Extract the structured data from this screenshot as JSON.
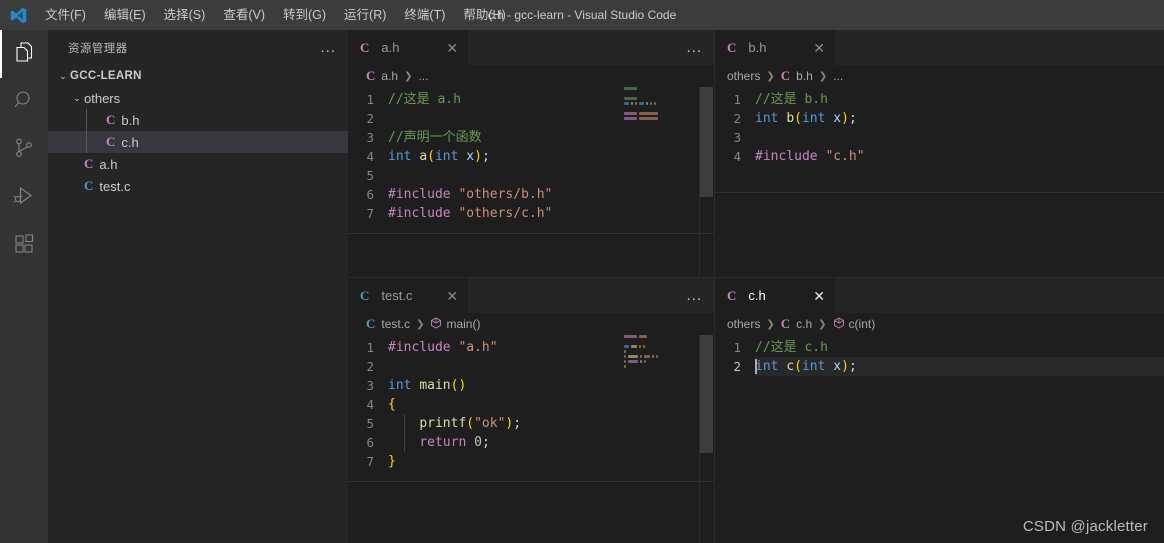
{
  "window": {
    "title": "c.h - gcc-learn - Visual Studio Code",
    "logo_name": "vscode-logo"
  },
  "menubar": {
    "items": [
      {
        "label": "文件(F)",
        "name": "menu-file"
      },
      {
        "label": "编辑(E)",
        "name": "menu-edit"
      },
      {
        "label": "选择(S)",
        "name": "menu-selection"
      },
      {
        "label": "查看(V)",
        "name": "menu-view"
      },
      {
        "label": "转到(G)",
        "name": "menu-go"
      },
      {
        "label": "运行(R)",
        "name": "menu-run"
      },
      {
        "label": "终端(T)",
        "name": "menu-terminal"
      },
      {
        "label": "帮助(H)",
        "name": "menu-help"
      }
    ]
  },
  "activitybar": {
    "items": [
      {
        "icon": "files-explorer-icon",
        "active": true
      },
      {
        "icon": "search-icon",
        "active": false
      },
      {
        "icon": "source-control-icon",
        "active": false
      },
      {
        "icon": "run-and-debug-icon",
        "active": false
      },
      {
        "icon": "extensions-icon",
        "active": false
      }
    ]
  },
  "sidebar": {
    "title": "资源管理器",
    "more_actions": "...",
    "root": {
      "label": "GCC-LEARN",
      "chevron": "⌄"
    },
    "tree": [
      {
        "label": "others",
        "type": "folder",
        "chevron": "⌄",
        "depth": 1,
        "selected": false
      },
      {
        "label": "b.h",
        "type": "header",
        "icon": "C",
        "depth": 2,
        "selected": false
      },
      {
        "label": "c.h",
        "type": "header",
        "icon": "C",
        "depth": 2,
        "selected": true
      },
      {
        "label": "a.h",
        "type": "header",
        "icon": "C",
        "depth": 1,
        "selected": false
      },
      {
        "label": "test.c",
        "type": "source",
        "icon": "C",
        "depth": 1,
        "selected": false
      }
    ]
  },
  "panes": {
    "a_h": {
      "tab": {
        "label": "a.h",
        "icon": "C",
        "icon_kind": "header",
        "close": "✕",
        "focused": false
      },
      "actions": "...",
      "breadcrumb": [
        {
          "text": "a.h",
          "icon": "C",
          "kind": "header"
        },
        {
          "text": "...",
          "kind": "ellipsis"
        }
      ],
      "lines": [
        {
          "n": "1",
          "tokens": [
            {
              "t": "//这是 a.h",
              "c": "cm"
            }
          ]
        },
        {
          "n": "2",
          "tokens": []
        },
        {
          "n": "3",
          "tokens": [
            {
              "t": "//声明一个函数",
              "c": "cm"
            }
          ]
        },
        {
          "n": "4",
          "tokens": [
            {
              "t": "int ",
              "c": "kw"
            },
            {
              "t": "a",
              "c": "fn"
            },
            {
              "t": "(",
              "c": "pr"
            },
            {
              "t": "int ",
              "c": "kw"
            },
            {
              "t": "x",
              "c": "vr"
            },
            {
              "t": ")",
              "c": "pr"
            },
            {
              "t": ";",
              "c": "plain"
            }
          ]
        },
        {
          "n": "5",
          "tokens": []
        },
        {
          "n": "6",
          "tokens": [
            {
              "t": "#include ",
              "c": "pp"
            },
            {
              "t": "\"others/b.h\"",
              "c": "st"
            }
          ]
        },
        {
          "n": "7",
          "tokens": [
            {
              "t": "#include ",
              "c": "pp"
            },
            {
              "t": "\"others/c.h\"",
              "c": "st"
            }
          ]
        }
      ]
    },
    "b_h": {
      "tab": {
        "label": "b.h",
        "icon": "C",
        "icon_kind": "header",
        "close": "✕",
        "focused": false
      },
      "actions": "",
      "breadcrumb": [
        {
          "text": "others",
          "kind": "folder"
        },
        {
          "text": "b.h",
          "icon": "C",
          "kind": "header"
        },
        {
          "text": "...",
          "kind": "ellipsis"
        }
      ],
      "lines": [
        {
          "n": "1",
          "tokens": [
            {
              "t": "//这是 b.h",
              "c": "cm"
            }
          ]
        },
        {
          "n": "2",
          "tokens": [
            {
              "t": "int ",
              "c": "kw"
            },
            {
              "t": "b",
              "c": "fn"
            },
            {
              "t": "(",
              "c": "pr"
            },
            {
              "t": "int ",
              "c": "kw"
            },
            {
              "t": "x",
              "c": "vr"
            },
            {
              "t": ")",
              "c": "pr"
            },
            {
              "t": ";",
              "c": "plain"
            }
          ]
        },
        {
          "n": "3",
          "tokens": []
        },
        {
          "n": "4",
          "tokens": [
            {
              "t": "#include ",
              "c": "pp"
            },
            {
              "t": "\"c.h\"",
              "c": "st"
            }
          ]
        }
      ]
    },
    "test_c": {
      "tab": {
        "label": "test.c",
        "icon": "C",
        "icon_kind": "source",
        "close": "✕",
        "focused": false
      },
      "actions": "...",
      "breadcrumb": [
        {
          "text": "test.c",
          "icon": "C",
          "kind": "source"
        },
        {
          "text": "main()",
          "kind": "symbol"
        }
      ],
      "lines": [
        {
          "n": "1",
          "tokens": [
            {
              "t": "#include ",
              "c": "pp"
            },
            {
              "t": "\"a.h\"",
              "c": "st"
            }
          ]
        },
        {
          "n": "2",
          "tokens": []
        },
        {
          "n": "3",
          "tokens": [
            {
              "t": "int ",
              "c": "kw"
            },
            {
              "t": "main",
              "c": "fn"
            },
            {
              "t": "(",
              "c": "pr"
            },
            {
              "t": ")",
              "c": "pr"
            }
          ]
        },
        {
          "n": "4",
          "tokens": [
            {
              "t": "{",
              "c": "pr"
            }
          ]
        },
        {
          "n": "5",
          "tokens": [
            {
              "t": "    ",
              "c": "plain"
            },
            {
              "t": "printf",
              "c": "fn"
            },
            {
              "t": "(",
              "c": "pr"
            },
            {
              "t": "\"ok\"",
              "c": "st"
            },
            {
              "t": ")",
              "c": "pr"
            },
            {
              "t": ";",
              "c": "plain"
            }
          ]
        },
        {
          "n": "6",
          "tokens": [
            {
              "t": "    ",
              "c": "plain"
            },
            {
              "t": "return ",
              "c": "pp"
            },
            {
              "t": "0",
              "c": "nm"
            },
            {
              "t": ";",
              "c": "plain"
            }
          ]
        },
        {
          "n": "7",
          "tokens": [
            {
              "t": "}",
              "c": "pr"
            }
          ]
        }
      ]
    },
    "c_h": {
      "tab": {
        "label": "c.h",
        "icon": "C",
        "icon_kind": "header",
        "close": "✕",
        "focused": true
      },
      "actions": "",
      "breadcrumb": [
        {
          "text": "others",
          "kind": "folder"
        },
        {
          "text": "c.h",
          "icon": "C",
          "kind": "header"
        },
        {
          "text": "c(int)",
          "kind": "symbol"
        }
      ],
      "lines": [
        {
          "n": "1",
          "tokens": [
            {
              "t": "//这是 c.h",
              "c": "cm"
            }
          ]
        },
        {
          "n": "2",
          "active": true,
          "tokens": [
            {
              "t": "int ",
              "c": "kw"
            },
            {
              "t": "c",
              "c": "fn"
            },
            {
              "t": "(",
              "c": "pr"
            },
            {
              "t": "int ",
              "c": "kw"
            },
            {
              "t": "x",
              "c": "vr"
            },
            {
              "t": ")",
              "c": "pr"
            },
            {
              "t": ";",
              "c": "plain"
            }
          ]
        }
      ]
    }
  },
  "watermark": "CSDN @jackletter",
  "colors": {
    "titlebar_bg": "#3c3c3c",
    "activitybar_bg": "#333333",
    "sidebar_bg": "#252526",
    "editor_bg": "#1e1e1e",
    "tabbar_bg": "#252526",
    "selected_row_bg": "#37373d",
    "accent_blue": "#569cd6",
    "comment_green": "#6a9955",
    "string_orange": "#ce9178",
    "preproc_purple": "#c586c0",
    "function_yellow": "#dcdcaa",
    "variable_lightblue": "#9cdcfe"
  }
}
